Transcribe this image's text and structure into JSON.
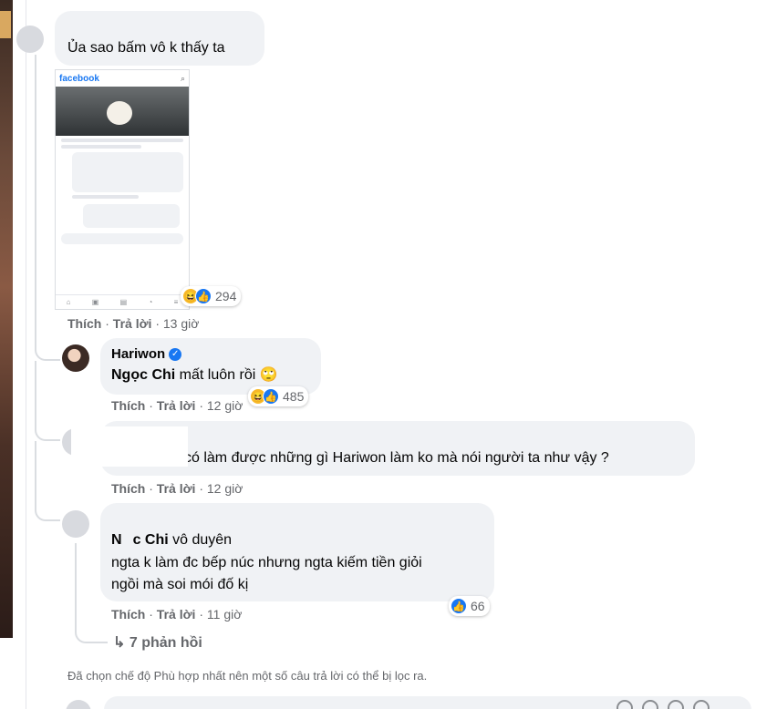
{
  "thread": {
    "top_comment": {
      "text": "Ủa sao bấm vô k thấy ta",
      "attachment": {
        "brand": "facebook",
        "nav_icons": [
          "home-icon",
          "video-icon",
          "marketplace-icon",
          "notifications-icon",
          "menu-icon"
        ]
      },
      "reactions": {
        "types": [
          "haha",
          "like"
        ],
        "count": "294"
      },
      "actions": {
        "like": "Thích",
        "reply": "Trả lời",
        "time": "13 giờ"
      }
    },
    "replies": [
      {
        "author": "Hariwon",
        "verified": true,
        "tag": "Ngọc Chi",
        "text": "mất luôn rồi 🙄",
        "reactions": {
          "types": [
            "haha",
            "like"
          ],
          "count": "485"
        },
        "actions": {
          "like": "Thích",
          "reply": "Trả lời",
          "time": "12 giờ"
        }
      },
      {
        "text": "có làm được những gì Hariwon làm ko mà nói người ta như vậy ?",
        "actions": {
          "like": "Thích",
          "reply": "Trả lời",
          "time": "12 giờ"
        }
      },
      {
        "tag_prefix": "N",
        "tag_suffix": "c Chi",
        "line1_rest": "vô duyên",
        "line2": "ngta k làm đc bếp núc nhưng ngta kiếm tiền giỏi",
        "line3": "ngồi mà soi mói đố kị",
        "reactions": {
          "types": [
            "like"
          ],
          "count": "66"
        },
        "actions": {
          "like": "Thích",
          "reply": "Trả lời",
          "time": "11 giờ"
        }
      }
    ],
    "more_replies": "7 phản hồi",
    "filter_notice": "Đã chọn chế độ Phù hợp nhất nên một số câu trả lời có thể bị lọc ra."
  },
  "colors": {
    "brand": "#1877f2",
    "bubble": "#f0f2f5",
    "meta": "#65676b"
  }
}
